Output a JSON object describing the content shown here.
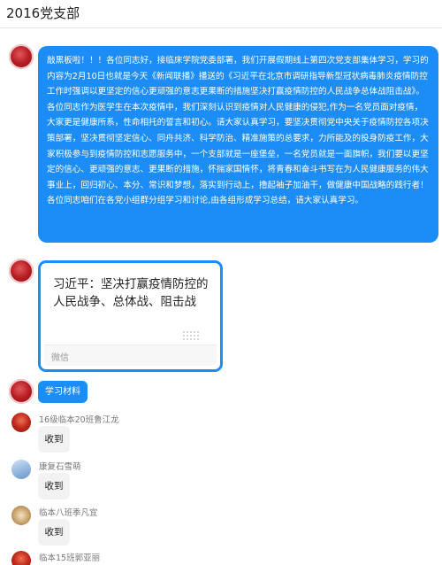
{
  "header": {
    "title": "2016党支部"
  },
  "messages": {
    "notice": {
      "text": "敲黑板啦！！！各位同志好，接临床学院党委部署，我们开展假期线上第四次党支部集体学习，学习的内容为2月10日也就是今天《新闻联播》播送的《习近平在北京市调研指导新型冠状病毒肺炎疫情防控工作时强调以更坚定的信心更顽强的意志更果断的措施坚决打赢疫情防控的人民战争总体战阻击战》。各位同志作为医学生在本次疫情中，我们深刻认识到疫情对人民健康的侵犯,作为一名党员面对疫情，大家更是健康所系，性命相托的誓言和初心。请大家认真学习，要坚决贯彻党中央关于疫情防控各项决策部署，坚决贯彻坚定信心、同舟共济、科学防治、精准施策的总要求，力所能及的投身防疫工作，大家积极参与到疫情防控和志愿服务中，一个支部就是一座堡垒，一名党员就是一面旗帜，我们要以更坚定的信心、更顽强的意志、更果断的措施，怀揣家国情怀，将青春和奋斗书写在为人民健康服务的伟大事业上，回归初心、本分、常识和梦想，落实到行动上，撸起袖子加油干，做健康中国战略的践行者！各位同志咱们在各党小组群分组学习和讨论,由各组形成学习总结，请大家认真学习。"
    },
    "link_card": {
      "title": "习近平：坚决打赢疫情防控的人民战争、总体战、阻击战",
      "source": "微信"
    },
    "label_pill": {
      "text": "学习材料"
    },
    "replies": [
      {
        "sender": "16级临本20班鲁江龙",
        "text": "收到",
        "avatar": "red-s"
      },
      {
        "sender": "康复石雪萌",
        "text": "收到",
        "avatar": "blue-s"
      },
      {
        "sender": "临本八班季凡宜",
        "text": "收到",
        "avatar": "olive-s"
      },
      {
        "sender": "临本15班郭亚丽",
        "text": "",
        "avatar": "red-s"
      }
    ]
  },
  "colors": {
    "bubble_blue": "#1c8cf6",
    "bubble_grey": "#f2f2f2",
    "avatar_red": "#b81d23"
  }
}
